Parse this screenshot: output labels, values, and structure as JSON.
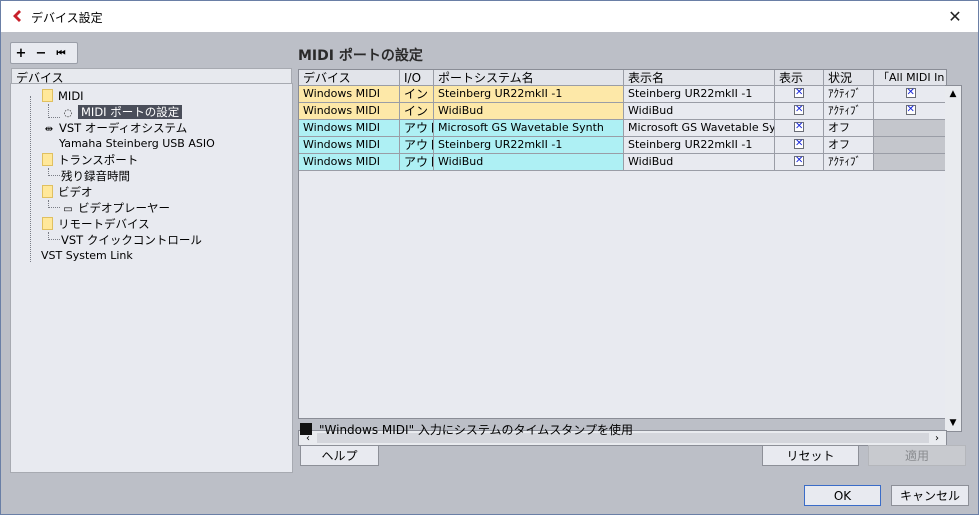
{
  "window": {
    "title": "デバイス設定"
  },
  "toolbar": {
    "add": "+",
    "remove": "−",
    "reset": "⏮"
  },
  "tree": {
    "header": "デバイス",
    "items": [
      {
        "label": "MIDI"
      },
      {
        "label": "MIDI ポートの設定"
      },
      {
        "label": "VST オーディオシステム"
      },
      {
        "label": "Yamaha Steinberg USB ASIO"
      },
      {
        "label": "トランスポート"
      },
      {
        "label": "残り録音時間"
      },
      {
        "label": "ビデオ"
      },
      {
        "label": "ビデオプレーヤー"
      },
      {
        "label": "リモートデバイス"
      },
      {
        "label": "VST クイックコントロール"
      },
      {
        "label": "VST System Link"
      }
    ]
  },
  "panel": {
    "title": "MIDI ポートの設定"
  },
  "table": {
    "columns": [
      "デバイス",
      "I/O",
      "ポートシステム名",
      "表示名",
      "表示",
      "状況",
      "「All MIDI In"
    ],
    "rows": [
      {
        "device": "Windows MIDI",
        "io": "イン",
        "port": "Steinberg UR22mkII -1",
        "display": "Steinberg UR22mkII -1",
        "show": true,
        "status": "ｱｸﾃｨﾌﾞ",
        "allin": true,
        "color": "#fde8a8"
      },
      {
        "device": "Windows MIDI",
        "io": "イン",
        "port": "WidiBud",
        "display": "WidiBud",
        "show": true,
        "status": "ｱｸﾃｨﾌﾞ",
        "allin": true,
        "color": "#fde8a8"
      },
      {
        "device": "Windows MIDI",
        "io": "アウト",
        "port": "Microsoft GS Wavetable Synth",
        "display": "Microsoft GS Wavetable Synth",
        "show": true,
        "status": "オフ",
        "allin": null,
        "color": "#aef0f4"
      },
      {
        "device": "Windows MIDI",
        "io": "アウト",
        "port": "Steinberg UR22mkII -1",
        "display": "Steinberg UR22mkII -1",
        "show": true,
        "status": "オフ",
        "allin": null,
        "color": "#aef0f4"
      },
      {
        "device": "Windows MIDI",
        "io": "アウト",
        "port": "WidiBud",
        "display": "WidiBud",
        "show": true,
        "status": "ｱｸﾃｨﾌﾞ",
        "allin": null,
        "color": "#aef0f4"
      }
    ]
  },
  "timestamp_option": {
    "label": "\"Windows MIDI\" 入力にシステムのタイムスタンプを使用",
    "checked": true
  },
  "buttons": {
    "help": "ヘルプ",
    "reset": "リセット",
    "apply": "適用",
    "ok": "OK",
    "cancel": "キャンセル"
  }
}
